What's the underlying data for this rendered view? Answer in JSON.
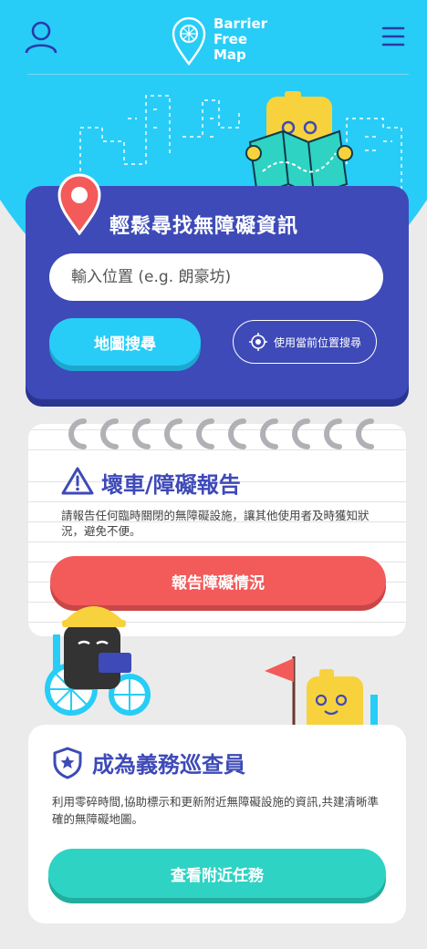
{
  "header": {
    "logo_lines": [
      "Barrier",
      "Free",
      "Map"
    ]
  },
  "search": {
    "title": "輕鬆尋找無障礙資訊",
    "placeholder": "輸入位置 (e.g. 朗豪坊)",
    "map_search_label": "地圖搜尋",
    "current_location_label": "使用當前位置搜尋"
  },
  "report": {
    "title": "壞車/障礙報告",
    "description": "請報告任何臨時關閉的無障礙設施，讓其他使用者及時獲知狀況，避免不便。",
    "button_label": "報告障礙情況"
  },
  "volunteer": {
    "title": "成為義務巡查員",
    "description": "利用零碎時間,協助標示和更新附近無障礙設施的資訊,共建清晰準確的無障礙地圖。",
    "button_label": "查看附近任務"
  },
  "colors": {
    "hero_blue": "#27cdf7",
    "navy": "#3e4ab7",
    "red": "#f35a5a",
    "teal": "#2ed3c3",
    "yellow": "#f7d23c"
  },
  "icons": [
    "user-icon",
    "map-pin-logo-icon",
    "menu-icon",
    "location-pin-icon",
    "locate-icon",
    "warning-icon",
    "star-shield-icon"
  ]
}
